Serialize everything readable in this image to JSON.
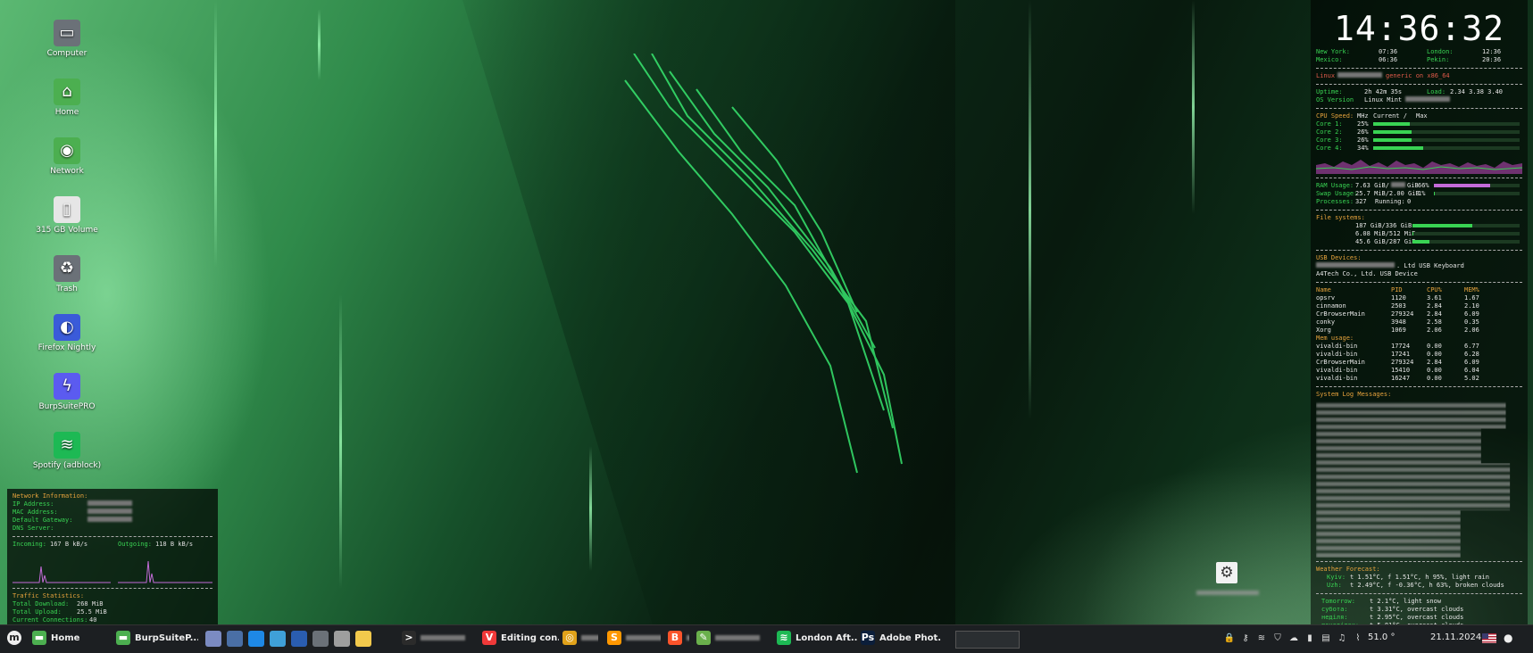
{
  "desktop_icons": [
    {
      "label": "Computer",
      "icon": "computer-icon",
      "glyph": "▭",
      "bg": "#6b7178"
    },
    {
      "label": "Home",
      "icon": "home-folder-icon",
      "glyph": "⌂",
      "bg": "#4caf50"
    },
    {
      "label": "Network",
      "icon": "network-folder-icon",
      "glyph": "◉",
      "bg": "#4caf50"
    },
    {
      "label": "315 GB Volume",
      "icon": "drive-icon",
      "glyph": "▯",
      "bg": "#e6e6e6"
    },
    {
      "label": "Trash",
      "icon": "trash-icon",
      "glyph": "♻",
      "bg": "#6b7178"
    },
    {
      "label": "Firefox Nightly",
      "icon": "firefox-icon",
      "glyph": "◐",
      "bg": "#3a5bd9"
    },
    {
      "label": "BurpSuitePRO",
      "icon": "burpsuite-icon",
      "glyph": "ϟ",
      "bg": "#5b5bf0"
    },
    {
      "label": "Spotify (adblock)",
      "icon": "spotify-icon",
      "glyph": "≋",
      "bg": "#1db954"
    }
  ],
  "conky_right": {
    "clock": "14:36:32",
    "world_clocks": [
      {
        "city": "New York:",
        "time": "07:36",
        "city2": "London:",
        "time2": "12:36"
      },
      {
        "city": "Mexico:",
        "time": "06:36",
        "city2": "Pekin:",
        "time2": "20:36"
      }
    ],
    "kernel_label": "Linux",
    "kernel_suffix": "generic on x86_64",
    "uptime_label": "Uptime:",
    "uptime": "2h 42m 35s",
    "load_label": "Load:",
    "load": "2.34 3.38 3.40",
    "os_label": "OS Version",
    "os": "Linux Mint",
    "cpu_header": {
      "label": "CPU Speed:",
      "mhz": "MHz",
      "current": "Current /",
      "max": "Max"
    },
    "cores": [
      {
        "label": "Core 1:",
        "value": "25%",
        "pct": 0.25
      },
      {
        "label": "Core 2:",
        "value": "26%",
        "pct": 0.26
      },
      {
        "label": "Core 3:",
        "value": "26%",
        "pct": 0.26
      },
      {
        "label": "Core 4:",
        "value": "34%",
        "pct": 0.34
      }
    ],
    "ram": {
      "label": "RAM Usage:",
      "used": "7.63 GiB/",
      "total": "GiB",
      "pct_text": "66%",
      "pct": 0.66
    },
    "swap": {
      "label": "Swap Usage:",
      "value": "25.7 MiB/2.00 GiB",
      "pct_text": "1%",
      "pct": 0.01
    },
    "processes": {
      "label": "Processes:",
      "value": "327",
      "running_label": "Running:",
      "running": "0"
    },
    "fs_label": "File systems:",
    "filesystems": [
      {
        "value": "187 GiB/336 GiB",
        "pct": 0.56
      },
      {
        "value": "6.08 MiB/512 MiB",
        "pct": 0.01
      },
      {
        "value": "45.6 GiB/287 GiB",
        "pct": 0.16
      }
    ],
    "usb_label": "USB Devices:",
    "usb_devices": [
      ". Ltd USB Keyboard",
      "A4Tech Co., Ltd. USB Device"
    ],
    "proc_header": {
      "name": "Name",
      "pid": "PID",
      "cpu": "CPU%",
      "mem": "MEM%"
    },
    "procs_cpu": [
      {
        "name": "opsrv",
        "pid": "1120",
        "cpu": "3.61",
        "mem": "1.67"
      },
      {
        "name": "cinnamon",
        "pid": "2503",
        "cpu": "2.84",
        "mem": "2.10"
      },
      {
        "name": "CrBrowserMain",
        "pid": "279324",
        "cpu": "2.84",
        "mem": "6.09"
      },
      {
        "name": "conky",
        "pid": "3948",
        "cpu": "2.58",
        "mem": "0.35"
      },
      {
        "name": "Xorg",
        "pid": "1069",
        "cpu": "2.06",
        "mem": "2.06"
      }
    ],
    "mem_usage_label": "Mem usage:",
    "procs_mem": [
      {
        "name": "vivaldi-bin",
        "pid": "17724",
        "cpu": "0.00",
        "mem": "6.77"
      },
      {
        "name": "vivaldi-bin",
        "pid": "17241",
        "cpu": "0.00",
        "mem": "6.28"
      },
      {
        "name": "CrBrowserMain",
        "pid": "279324",
        "cpu": "2.84",
        "mem": "6.09"
      },
      {
        "name": "vivaldi-bin",
        "pid": "15410",
        "cpu": "0.00",
        "mem": "6.04"
      },
      {
        "name": "vivaldi-bin",
        "pid": "16247",
        "cpu": "0.00",
        "mem": "5.02"
      }
    ],
    "syslog_label": "System Log Messages:",
    "weather_label": "Weather Forecast:",
    "weather_now": [
      {
        "city": "Kyiv:",
        "text": "t 1.51°C, f 1.51°C, h 95%, light rain"
      },
      {
        "city": "Uzh:",
        "text": "t 2.49°C, f -0.36°C, h 63%, broken clouds"
      }
    ],
    "forecast": [
      {
        "day": "Tomorrow:",
        "text": "t 2.1°C, light snow"
      },
      {
        "day": "субота:",
        "text": "t 3.31°C, overcast clouds"
      },
      {
        "day": "неділя:",
        "text": "t 2.95°C, overcast clouds"
      },
      {
        "day": "понеділок:",
        "text": "t 5.81°C, overcast clouds"
      }
    ]
  },
  "conky_left": {
    "title": "Network Information:",
    "labels": [
      "IP Address:",
      "MAC Address:",
      "Default Gateway:",
      "DNS Server:"
    ],
    "incoming_label": "Incoming:",
    "incoming": "167 B kB/s",
    "outgoing_label": "Outgoing:",
    "outgoing": "118 B kB/s",
    "traffic_title": "Traffic Statistics:",
    "total_download_label": "Total Download:",
    "total_download": "268 MiB",
    "total_upload_label": "Total Upload:",
    "total_upload": "25.5 MiB",
    "connections_label": "Current Connections:",
    "connections": "40"
  },
  "taskbar": {
    "windows": [
      {
        "label": "Home",
        "icon": "folder-icon",
        "color": "#4caf50",
        "glyph": "▬"
      },
      {
        "label": "BurpSuiteP...",
        "icon": "folder-icon",
        "color": "#4caf50",
        "glyph": "▬"
      },
      {
        "label": "",
        "icon": "terminal-icon",
        "color": "#2b2b2b",
        "glyph": ">"
      },
      {
        "label": "Editing con...",
        "icon": "vivaldi-icon",
        "color": "#ef3939",
        "glyph": "V"
      },
      {
        "label": "",
        "icon": "chrome-icon",
        "color": "#e0a21a",
        "glyph": "◎"
      },
      {
        "label": "",
        "icon": "sublime-icon",
        "color": "#ff9800",
        "glyph": "S"
      },
      {
        "label": "",
        "icon": "brave-icon",
        "color": "#fb542b",
        "glyph": "B"
      },
      {
        "label": "",
        "icon": "keepass-icon",
        "color": "#6ab04c",
        "glyph": "✎"
      },
      {
        "label": "London Aft...",
        "icon": "spotify-icon",
        "color": "#1db954",
        "glyph": "≋"
      },
      {
        "label": "Adobe Phot...",
        "icon": "photoshop-icon",
        "color": "#0b1e3a",
        "glyph": "Ps"
      }
    ],
    "temperature": "51.0 °",
    "date": "21.11.2024",
    "tray_icons": [
      "lock-icon",
      "key-icon",
      "spotify-tray-icon",
      "shield-icon",
      "cloud-icon",
      "battery-icon",
      "clipboard-icon",
      "music-icon",
      "thermometer-icon"
    ]
  }
}
